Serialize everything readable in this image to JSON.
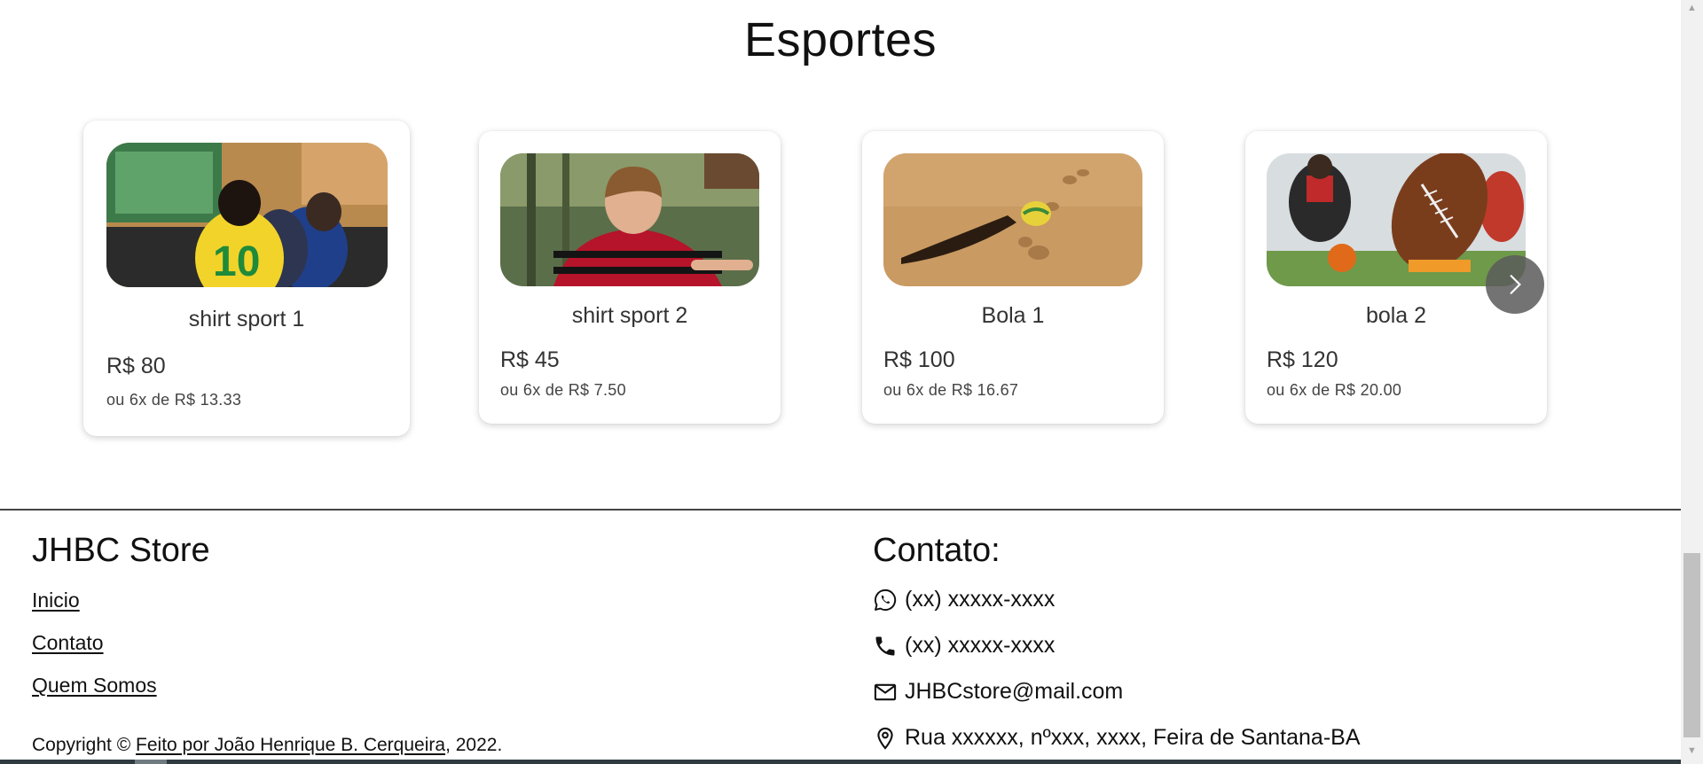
{
  "section": {
    "title": "Esportes"
  },
  "products": [
    {
      "name": "shirt sport 1",
      "price": "R$ 80",
      "installments": "ou 6x de R$ 13.33",
      "image": "kid-jersey-10-watching-tv"
    },
    {
      "name": "shirt sport 2",
      "price": "R$ 45",
      "installments": "ou 6x de R$ 7.50",
      "image": "boy-red-black-jersey"
    },
    {
      "name": "Bola 1",
      "price": "R$ 100",
      "installments": "ou 6x de R$ 16.67",
      "image": "ball-on-sand"
    },
    {
      "name": "bola 2",
      "price": "R$ 120",
      "installments": "ou 6x de R$ 20.00",
      "image": "american-football-on-tee"
    }
  ],
  "carousel": {
    "next_icon": "chevron-right-icon"
  },
  "footer": {
    "brand": "JHBC Store",
    "links": [
      "Inicio",
      "Contato",
      "Quem Somos"
    ],
    "contact_title": "Contato:",
    "contacts": [
      {
        "icon": "whatsapp-icon",
        "text": "(xx) xxxxx-xxxx"
      },
      {
        "icon": "phone-icon",
        "text": "(xx) xxxxx-xxxx"
      },
      {
        "icon": "mail-icon",
        "text": "JHBCstore@mail.com"
      },
      {
        "icon": "location-pin-icon",
        "text": "Rua xxxxxx, nºxxx, xxxx, Feira de Santana-BA"
      }
    ],
    "copyright_prefix": "Copyright © ",
    "copyright_link": "Feito por João Henrique B. Cerqueira",
    "copyright_suffix": ", 2022."
  }
}
